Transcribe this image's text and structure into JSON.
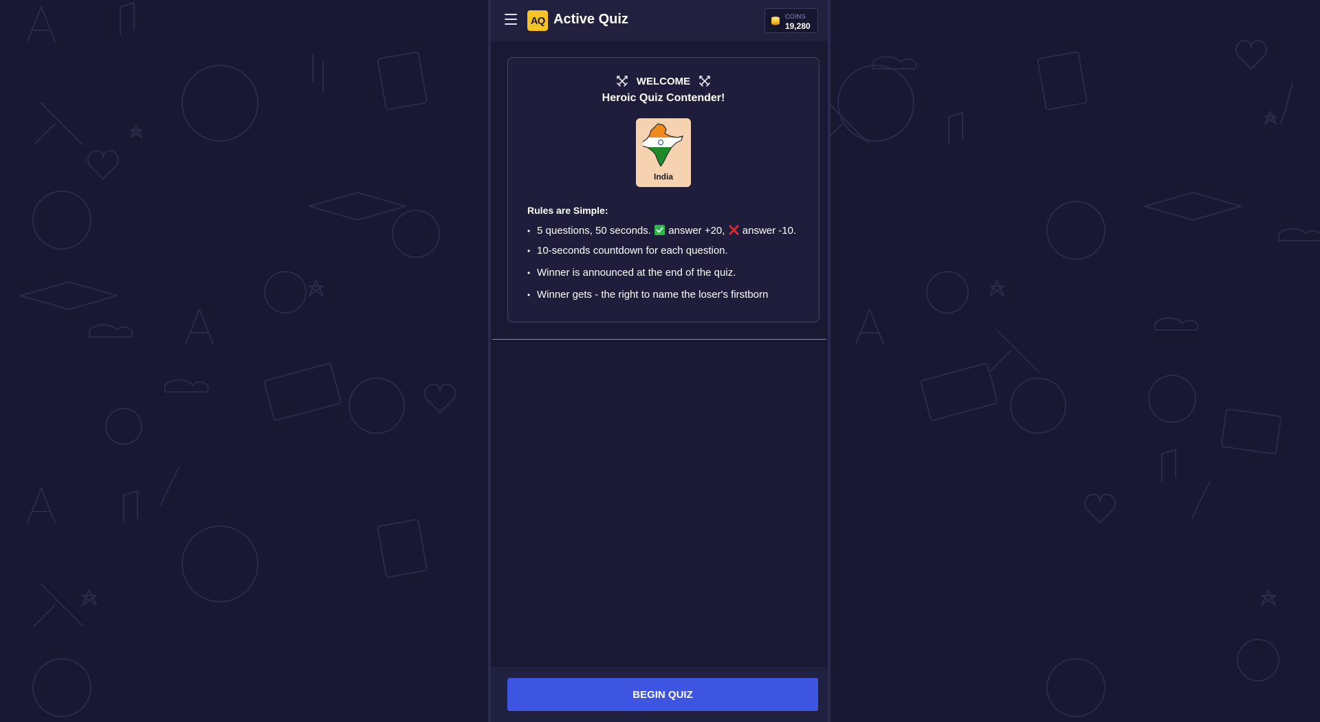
{
  "header": {
    "menu_icon": "hamburger-menu-icon",
    "logo_text": "AQ",
    "title": "Active Quiz",
    "coins": {
      "icon": "coin-stack-icon",
      "label": "COINS",
      "value": "19,280"
    }
  },
  "welcome": {
    "icon": "crossed-swords-icon",
    "heading": "WELCOME",
    "subtitle": "Heroic Quiz Contender!"
  },
  "topic": {
    "icon": "india-map-flag-icon",
    "label": "India"
  },
  "rules": {
    "title": "Rules are Simple:",
    "item1": {
      "part1": "5 questions, 50 seconds.",
      "correct_icon": "check-mark-icon",
      "part2": "answer +20,",
      "wrong_icon": "cross-mark-icon",
      "part3": "answer -10."
    },
    "items": [
      "10-seconds countdown for each question.",
      "Winner is announced at the end of the quiz.",
      "Winner gets - the right to name the loser's firstborn"
    ]
  },
  "footer": {
    "begin_label": "BEGIN QUIZ"
  },
  "colors": {
    "page_bg": "#181832",
    "panel_bg": "#191933",
    "header_bg": "#21213f",
    "accent_button": "#3d55e0",
    "logo_yellow": "#f7c325",
    "topic_card": "#f6d2b0"
  }
}
